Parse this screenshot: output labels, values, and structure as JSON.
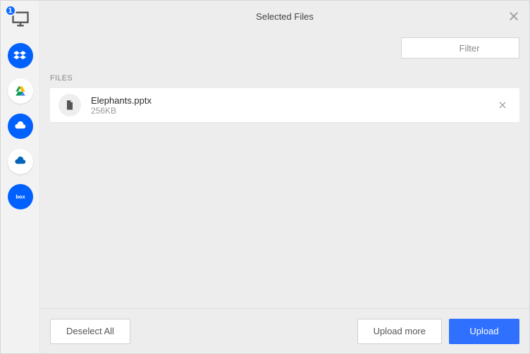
{
  "header": {
    "title": "Selected Files"
  },
  "filter": {
    "placeholder": "Filter"
  },
  "sources": {
    "badge_count": "1",
    "items": [
      {
        "id": "local",
        "name": "local-computer-icon"
      },
      {
        "id": "dropbox",
        "name": "dropbox-icon"
      },
      {
        "id": "google-drive",
        "name": "google-drive-icon"
      },
      {
        "id": "onedrive",
        "name": "onedrive-icon"
      },
      {
        "id": "onedrive-biz",
        "name": "onedrive-business-icon"
      },
      {
        "id": "box",
        "name": "box-icon"
      }
    ]
  },
  "files_label": "FILES",
  "files": [
    {
      "name": "Elephants.pptx",
      "size": "256KB"
    }
  ],
  "footer": {
    "deselect": "Deselect All",
    "upload_more": "Upload more",
    "upload": "Upload"
  }
}
